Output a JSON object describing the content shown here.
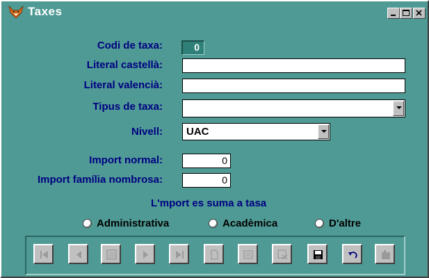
{
  "window": {
    "title": "Taxes",
    "accent_color": "#4f9a95",
    "label_color": "#000080"
  },
  "titlebar": {
    "icons": [
      "fox-app-icon",
      "minimize-icon",
      "maximize-icon",
      "close-icon"
    ]
  },
  "form": {
    "codi_label": "Codi de taxa:",
    "codi_value": "0",
    "literal_castella_label": "Literal castellà:",
    "literal_castella_value": "",
    "literal_valencia_label": "Literal valencià:",
    "literal_valencia_value": "",
    "tipus_label": "Tipus de taxa:",
    "tipus_value": "",
    "nivell_label": "Nivell:",
    "nivell_value": "UAC",
    "import_normal_label": "Import normal:",
    "import_normal_value": "0",
    "import_familia_label": "Import família nombrosa:",
    "import_familia_value": "0"
  },
  "tasa": {
    "label": "L'mport es suma a tasa",
    "options": [
      "Administrativa",
      "Acadèmica",
      "D'altre"
    ]
  },
  "toolbar": {
    "buttons": [
      "first-record",
      "previous-record",
      "search",
      "next-record",
      "last-record",
      "new-record",
      "edit-record",
      "delete-record",
      "save",
      "undo",
      "exit"
    ]
  }
}
